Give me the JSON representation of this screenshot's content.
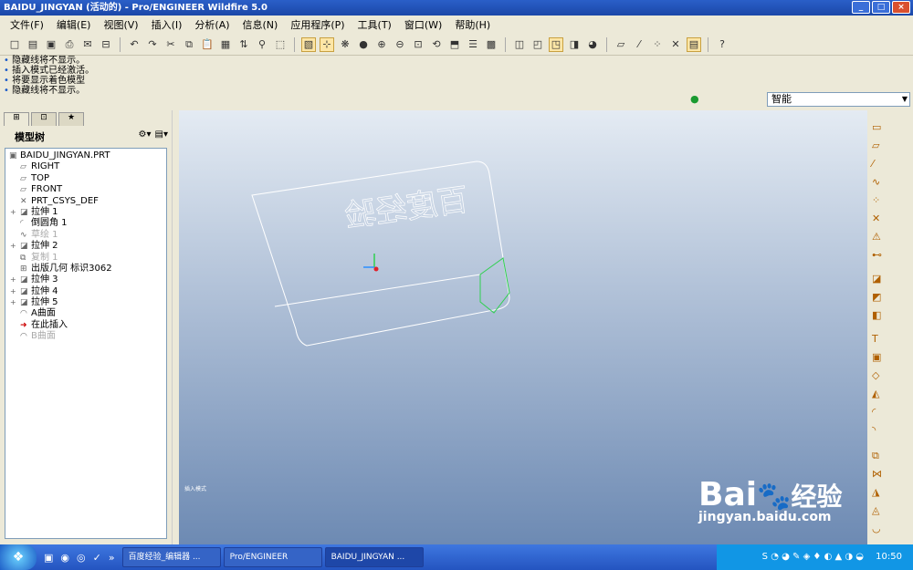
{
  "window": {
    "title": "BAIDU_JINGYAN (活动的) - Pro/ENGINEER Wildfire 5.0"
  },
  "menu": [
    "文件(F)",
    "编辑(E)",
    "视图(V)",
    "插入(I)",
    "分析(A)",
    "信息(N)",
    "应用程序(P)",
    "工具(T)",
    "窗口(W)",
    "帮助(H)"
  ],
  "messages": [
    "隐藏线将不显示。",
    "插入模式已经激活。",
    "将要显示着色模型",
    "隐藏线将不显示。"
  ],
  "filter": {
    "selected": "智能"
  },
  "model_tree": {
    "title": "模型树",
    "nodes": [
      {
        "label": "BAIDU_JINGYAN.PRT",
        "root": true,
        "icon": "part-icon"
      },
      {
        "label": "RIGHT",
        "icon": "datum-plane-icon"
      },
      {
        "label": "TOP",
        "icon": "datum-plane-icon"
      },
      {
        "label": "FRONT",
        "icon": "datum-plane-icon"
      },
      {
        "label": "PRT_CSYS_DEF",
        "icon": "csys-icon"
      },
      {
        "label": "拉伸 1",
        "icon": "extrude-icon",
        "expand": true
      },
      {
        "label": "倒圆角 1",
        "icon": "round-icon"
      },
      {
        "label": "草绘 1",
        "icon": "sketch-icon",
        "dim": true
      },
      {
        "label": "拉伸 2",
        "icon": "extrude-icon",
        "expand": true
      },
      {
        "label": "复制 1",
        "icon": "copy-icon",
        "dim": true
      },
      {
        "label": "出版几何 标识3062",
        "icon": "publish-geom-icon"
      },
      {
        "label": "拉伸 3",
        "icon": "extrude-icon",
        "expand": true
      },
      {
        "label": "拉伸 4",
        "icon": "extrude-icon",
        "expand": true
      },
      {
        "label": "拉伸 5",
        "icon": "extrude-icon",
        "expand": true
      },
      {
        "label": "A曲面",
        "icon": "surface-icon"
      },
      {
        "label": "在此插入",
        "icon": "insert-here-icon"
      },
      {
        "label": "B曲面",
        "icon": "surface-icon",
        "dim": true
      }
    ]
  },
  "canvas": {
    "mirrored_text": "百度经验",
    "mode_label": "插入模式"
  },
  "taskbar": {
    "tasks": [
      {
        "label": "百度经验_编辑器 ..."
      },
      {
        "label": "Pro/ENGINEER"
      },
      {
        "label": "BAIDU_JINGYAN ..."
      }
    ],
    "clock": "10:50"
  },
  "watermark": {
    "brand": "Bai",
    "brand2": "经验",
    "url": "jingyan.baidu.com"
  }
}
